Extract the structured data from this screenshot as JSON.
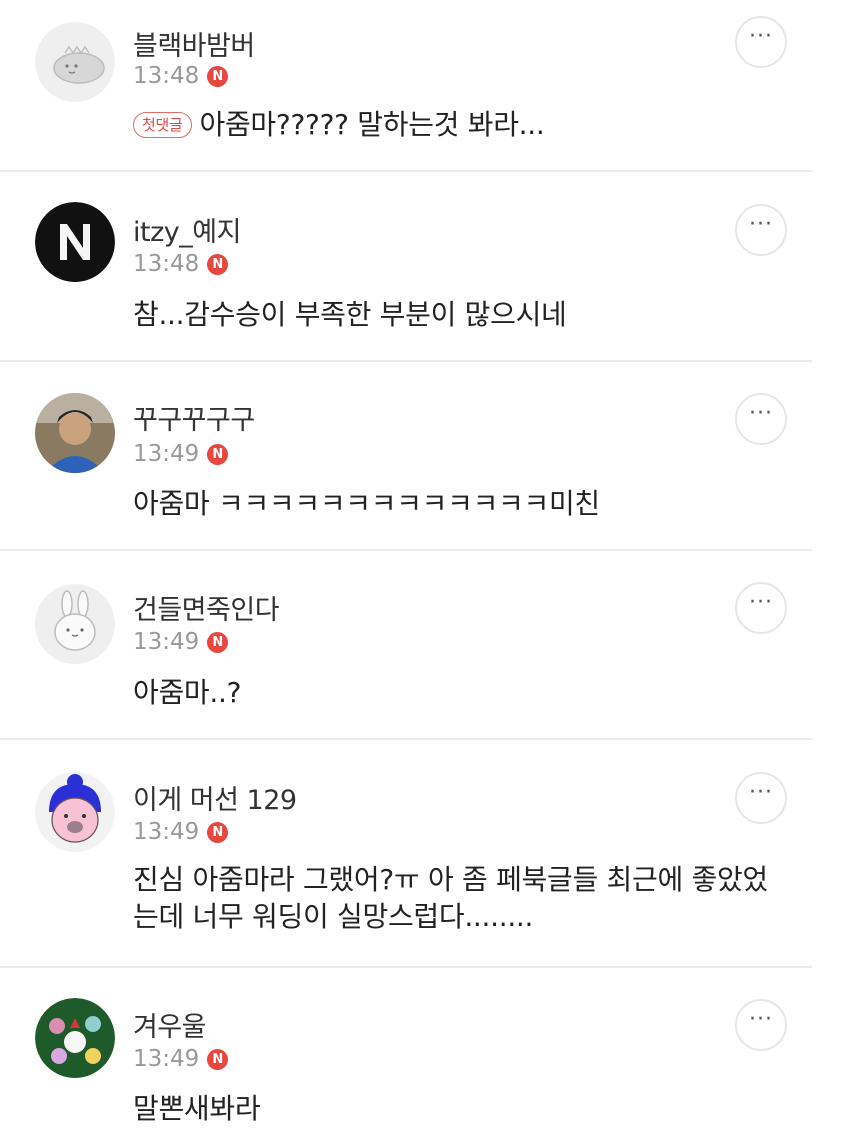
{
  "more_button_glyph": "···",
  "badge_letter": "N",
  "first_comment_badge": "첫댓글",
  "accent_color": "#e8473d",
  "comments": [
    {
      "nickname": "블랙바밤버",
      "time": "13:48",
      "text": "아줌마????? 말하는것 봐라...",
      "avatar_icon": "dinosaur-avatar-icon"
    },
    {
      "nickname": "itzy_예지",
      "time": "13:48",
      "text": "참...감수승이 부족한 부분이 많으시네",
      "avatar_icon": "n-logo-avatar-icon"
    },
    {
      "nickname": "꾸구꾸구구",
      "time": "13:49",
      "text": "아줌마 ㅋㅋㅋㅋㅋㅋㅋㅋㅋㅋㅋㅋㅋ미친",
      "avatar_icon": "photo-avatar-icon"
    },
    {
      "nickname": "건들면죽인다",
      "time": "13:49",
      "text": "아줌마..?",
      "avatar_icon": "rabbit-avatar-icon"
    },
    {
      "nickname": "이게 머선 129",
      "time": "13:49",
      "text": "진심 아줌마라 그랬어?ㅠ 아 좀 페북글들 최근에 좋았었는데 너무 워딩이 실망스럽다........",
      "avatar_icon": "cartoon-character-avatar-icon"
    },
    {
      "nickname": "겨우울",
      "time": "13:49",
      "text": "말뽄새봐라",
      "avatar_icon": "christmas-animals-avatar-icon"
    }
  ]
}
